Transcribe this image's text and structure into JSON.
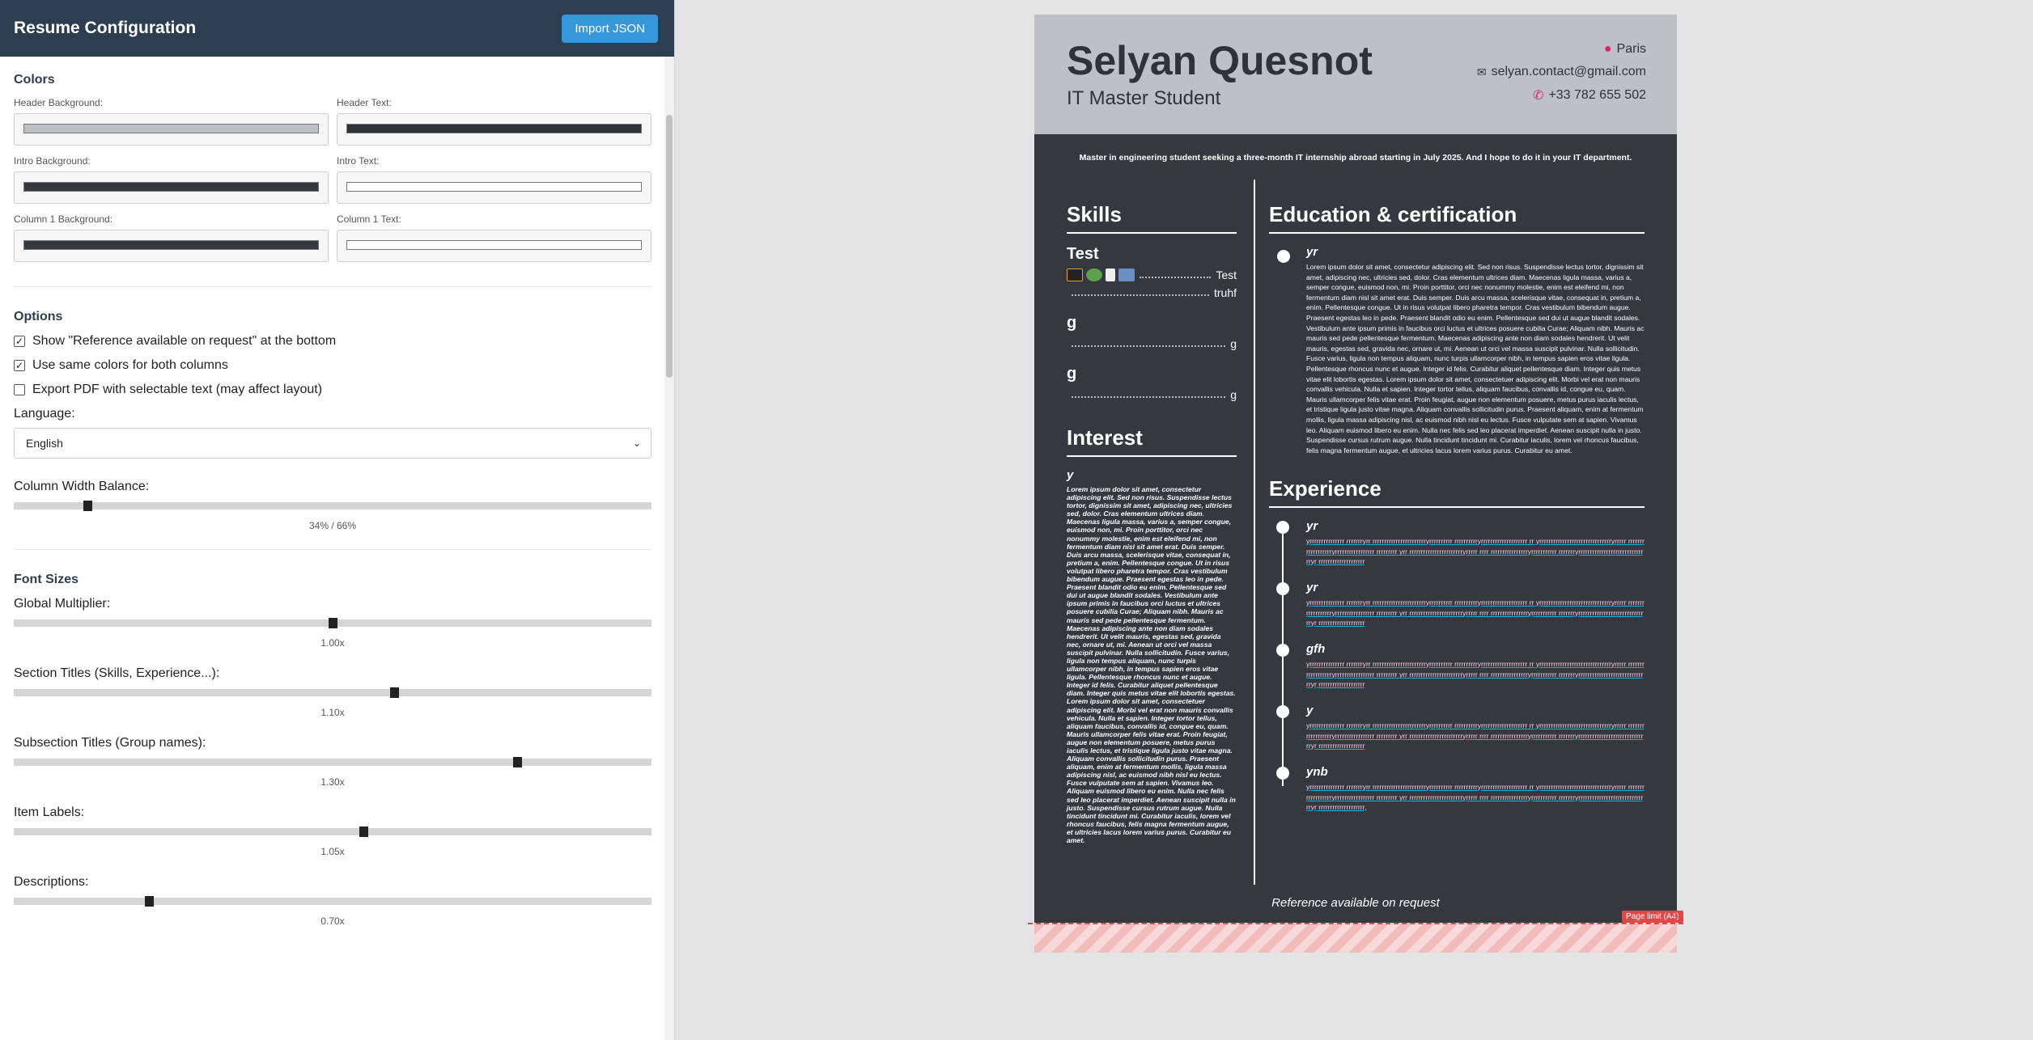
{
  "panel": {
    "title": "Resume Configuration",
    "import_label": "Import JSON",
    "colors": {
      "section_title": "Colors",
      "items": [
        {
          "label": "Header Background:",
          "color": "#bdc1c6"
        },
        {
          "label": "Header Text:",
          "color": "#2f3237"
        },
        {
          "label": "Intro Background:",
          "color": "#35383e"
        },
        {
          "label": "Intro Text:",
          "color": "#ffffff"
        },
        {
          "label": "Column 1 Background:",
          "color": "#35383e"
        },
        {
          "label": "Column 1 Text:",
          "color": "#ffffff"
        }
      ]
    },
    "options": {
      "section_title": "Options",
      "show_reference": {
        "label": "Show \"Reference available on request\" at the bottom",
        "checked": true
      },
      "same_colors": {
        "label": "Use same colors for both columns",
        "checked": true
      },
      "selectable_pdf": {
        "label": "Export PDF with selectable text (may affect layout)",
        "checked": false
      },
      "language_label": "Language:",
      "language_value": "English",
      "column_balance_label": "Column Width Balance:",
      "column_balance_value": "34% / 66%",
      "column_balance_fraction": 0.115
    },
    "font_sizes": {
      "section_title": "Font Sizes",
      "sliders": [
        {
          "label": "Global Multiplier:",
          "value": "1.00x",
          "fraction": 0.5
        },
        {
          "label": "Section Titles (Skills, Experience...):",
          "value": "1.10x",
          "fraction": 0.596
        },
        {
          "label": "Subsection Titles (Group names):",
          "value": "1.30x",
          "fraction": 0.789
        },
        {
          "label": "Item Labels:",
          "value": "1.05x",
          "fraction": 0.548
        },
        {
          "label": "Descriptions:",
          "value": "0.70x",
          "fraction": 0.212
        }
      ]
    }
  },
  "resume": {
    "name": "Selyan Quesnot",
    "title": "IT Master Student",
    "contact": {
      "location": "Paris",
      "email": "selyan.contact@gmail.com",
      "phone": "+33 782 655 502"
    },
    "intro": "Master in engineering student seeking a three-month IT internship abroad starting in July 2025. And I hope to do it in your IT department.",
    "skills": {
      "section_title": "Skills",
      "groups": [
        {
          "name": "Test",
          "items": [
            "Test",
            "truhf"
          ]
        },
        {
          "name": "g",
          "items": [
            "g"
          ]
        },
        {
          "name": "g",
          "items": [
            "g"
          ]
        }
      ]
    },
    "interest": {
      "section_title": "Interest",
      "item_title": "y",
      "text": "Lorem ipsum dolor sit amet, consectetur adipiscing elit. Sed non risus. Suspendisse lectus tortor, dignissim sit amet, adipiscing nec, ultricies sed, dolor. Cras elementum ultrices diam. Maecenas ligula massa, varius a, semper congue, euismod non, mi. Proin porttitor, orci nec nonummy molestie, enim est eleifend mi, non fermentum diam nisl sit amet erat. Duis semper. Duis arcu massa, scelerisque vitae, consequat in, pretium a, enim. Pellentesque congue. Ut in risus volutpat libero pharetra tempor. Cras vestibulum bibendum augue. Praesent egestas leo in pede. Praesent blandit odio eu enim. Pellentesque sed dui ut augue blandit sodales. Vestibulum ante ipsum primis in faucibus orci luctus et ultrices posuere cubilia Curae; Aliquam nibh. Mauris ac mauris sed pede pellentesque fermentum. Maecenas adipiscing ante non diam sodales hendrerit. Ut velit mauris, egestas sed, gravida nec, ornare ut, mi. Aenean ut orci vel massa suscipit pulvinar. Nulla sollicitudin. Fusce varius, ligula non tempus aliquam, nunc turpis ullamcorper nibh, in tempus sapien eros vitae ligula. Pellentesque rhoncus nunc et augue. Integer id felis. Curabitur aliquet pellentesque diam. Integer quis metus vitae elit lobortis egestas. Lorem ipsum dolor sit amet, consectetuer adipiscing elit. Morbi vel erat non mauris convallis vehicula. Nulla et sapien. Integer tortor tellus, aliquam faucibus, convallis id, congue eu, quam. Mauris ullamcorper felis vitae erat. Proin feugiat, augue non elementum posuere, metus purus iaculis lectus, et tristique ligula justo vitae magna. Aliquam convallis sollicitudin purus. Praesent aliquam, enim at fermentum mollis, ligula massa adipiscing nisl, ac euismod nibh nisl eu lectus. Fusce vulputate sem at sapien. Vivamus leo. Aliquam euismod libero eu enim. Nulla nec felis sed leo placerat imperdiet. Aenean suscipit nulla in justo. Suspendisse cursus rutrum augue. Nulla tincidunt tincidunt mi. Curabitur iaculis, lorem vel rhoncus faucibus, felis magna fermentum augue, et ultricies lacus lorem varius purus. Curabitur eu amet."
    },
    "education": {
      "section_title": "Education & certification",
      "items": [
        {
          "title": "yr",
          "text": "Lorem ipsum dolor sit amet, consectetur adipiscing elit. Sed non risus. Suspendisse lectus tortor, dignissim sit amet, adipiscing nec, ultricies sed, dolor. Cras elementum ultrices diam. Maecenas ligula massa, varius a, semper congue, euismod non, mi. Proin porttitor, orci nec nonummy molestie, enim est eleifend mi, non fermentum diam nisl sit amet erat. Duis semper. Duis arcu massa, scelerisque vitae, consequat in, pretium a, enim. Pellentesque congue. Ut in risus volutpat libero pharetra tempor. Cras vestibulum bibendum augue. Praesent egestas leo in pede. Praesent blandit odio eu enim. Pellentesque sed dui ut augue blandit sodales. Vestibulum ante ipsum primis in faucibus orci luctus et ultrices posuere cubilia Curae; Aliquam nibh. Mauris ac mauris sed pede pellentesque fermentum. Maecenas adipiscing ante non diam sodales hendrerit. Ut velit mauris, egestas sed, gravida nec, ornare ut, mi. Aenean ut orci vel massa suscipit pulvinar. Nulla sollicitudin. Fusce varius, ligula non tempus aliquam, nunc turpis ullamcorper nibh, in tempus sapien eros vitae ligula. Pellentesque rhoncus nunc et augue. Integer id felis. Curabitur aliquet pellentesque diam. Integer quis metus vitae elit lobortis egestas. Lorem ipsum dolor sit amet, consectetuer adipiscing elit. Morbi vel erat non mauris convallis vehicula. Nulla et sapien. Integer tortor tellus, aliquam faucibus, convallis id, congue eu, quam. Mauris ullamcorper felis vitae erat. Proin feugiat, augue non elementum posuere, metus purus iaculis lectus, et tristique ligula justo vitae magna. Aliquam convallis sollicitudin purus. Praesent aliquam, enim at fermentum mollis, ligula massa adipiscing nisl, ac euismod nibh nisl eu lectus. Fusce vulputate sem at sapien. Vivamus leo. Aliquam euismod libero eu enim. Nulla nec felis sed leo placerat imperdiet. Aenean suscipit nulla in justo. Suspendisse cursus rutrum augue. Nulla tincidunt tincidunt mi. Curabitur iaculis, lorem vel rhoncus faucibus, felis magna fermentum augue, et ultricies lacus lorem varius purus. Curabitur eu amet."
        }
      ]
    },
    "experience": {
      "section_title": "Experience",
      "items": [
        {
          "title": "yr",
          "text": "yrrrrrrrrrrrrrrr rrrrrrryrr rrrrrrrrrrrrrrrrrrrrrrryrrrrrrrrrr rrrrrrrrrryrrrrrrrrrrrrrrrrrrrr rr yrrrrrrrrrrrrrrrrrrrrrrrrrrrrrrryrrrrr rrrrrrrrrrrrrrrrrryrrrrrrrrrrrrrrrrr rrrrrrrrr yrr rrrrrrrrrrrrrrrrrrrrrrryrrrrr rrrr rrrrrrrrrrrrrrrryrrrrrrrrrrr rrrrrrryrrrrrrrrrrrrrrrrrrrrrrrrrrrrrryr rrrrrrrrrrrrrrrrrrrr"
        },
        {
          "title": "yr",
          "text": "yrrrrrrrrrrrrrrr rrrrrrryrr rrrrrrrrrrrrrrrrrrrrrrryrrrrrrrrrr rrrrrrrrrryrrrrrrrrrrrrrrrrrrrr rr yrrrrrrrrrrrrrrrrrrrrrrrrrrrrrrryrrrrr rrrrrrrrrrrrrrrrrryrrrrrrrrrrrrrrrrr rrrrrrrrr yrr rrrrrrrrrrrrrrrrrrrrrrryrrrrr rrrr rrrrrrrrrrrrrrrryrrrrrrrrrrr rrrrrrryrrrrrrrrrrrrrrrrrrrrrrrrrrrrrryr rrrrrrrrrrrrrrrrrrrr"
        },
        {
          "title": "gfh",
          "text": "yrrrrrrrrrrrrrrr rrrrrrryrr rrrrrrrrrrrrrrrrrrrrrrryrrrrrrrrrr rrrrrrrrrryrrrrrrrrrrrrrrrrrrrr rr yrrrrrrrrrrrrrrrrrrrrrrrrrrrrrrryrrrrr rrrrrrrrrrrrrrrrrryrrrrrrrrrrrrrrrrr rrrrrrrrr yrr rrrrrrrrrrrrrrrrrrrrrrryrrrrr rrrr rrrrrrrrrrrrrrrryrrrrrrrrrrr rrrrrrryrrrrrrrrrrrrrrrrrrrrrrrrrrrrrryr rrrrrrrrrrrrrrrrrrrr"
        },
        {
          "title": "y",
          "text": "yrrrrrrrrrrrrrrr rrrrrrryrr rrrrrrrrrrrrrrrrrrrrrrryrrrrrrrrrr rrrrrrrrrryrrrrrrrrrrrrrrrrrrrr rr yrrrrrrrrrrrrrrrrrrrrrrrrrrrrrrryrrrrr rrrrrrrrrrrrrrrrrryrrrrrrrrrrrrrrrrr rrrrrrrrr yrr rrrrrrrrrrrrrrrrrrrrrrryrrrrr rrrr rrrrrrrrrrrrrrrryrrrrrrrrrrr rrrrrrryrrrrrrrrrrrrrrrrrrrrrrrrrrrrrryr rrrrrrrrrrrrrrrrrrrr"
        },
        {
          "title": "ynb",
          "text": "yrrrrrrrrrrrrrrr rrrrrrryrr rrrrrrrrrrrrrrrrrrrrrrryrrrrrrrrrr rrrrrrrrrryrrrrrrrrrrrrrrrrrrrr rr yrrrrrrrrrrrrrrrrrrrrrrrrrrrrrrryrrrrr rrrrrrrrrrrrrrrrrryrrrrrrrrrrrrrrrrr rrrrrrrrr yrr rrrrrrrrrrrrrrrrrrrrrrryrrrrr rrrr rrrrrrrrrrrrrrrryrrrrrrrrrrr rrrrrrryrrrrrrrrrrrrrrrrrrrrrrrrrrrrrryr rrrrrrrrrrrrrrrrrrrr,"
        }
      ]
    },
    "reference": "Reference available on request",
    "page_limit": "Page limit (A4)"
  }
}
